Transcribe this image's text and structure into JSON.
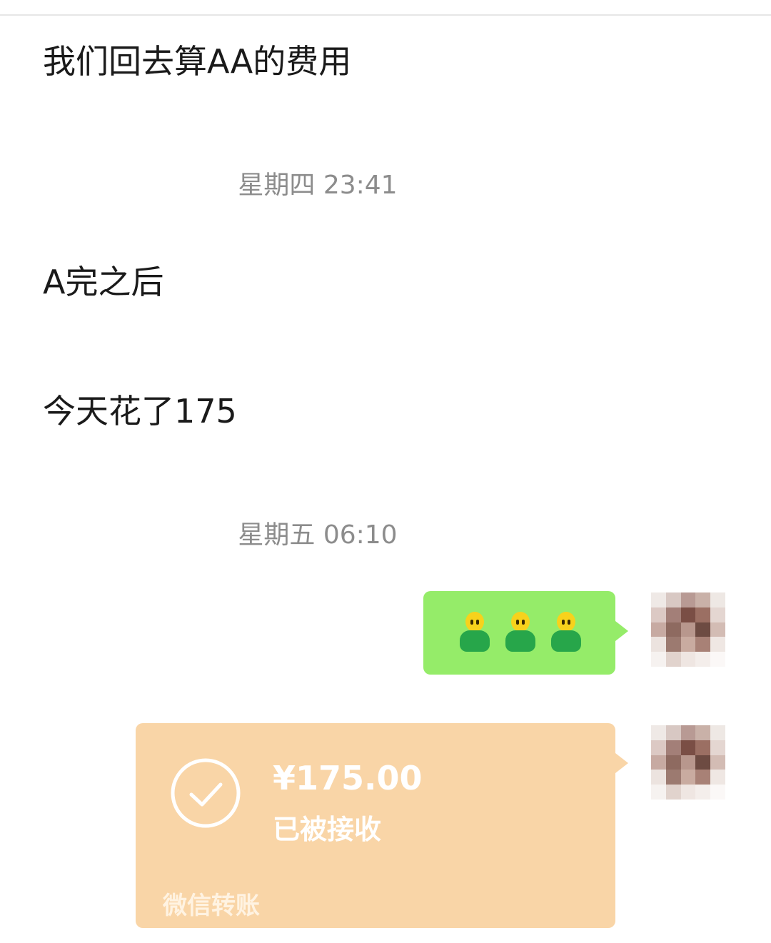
{
  "messages": {
    "m1": "我们回去算AA的费用",
    "ts1": "星期四 23:41",
    "m2": "A完之后",
    "m3": "今天花了175",
    "ts2": "星期五 06:10"
  },
  "sent_emoji": {
    "icon": "person-green-shirt-emoji",
    "count": 3
  },
  "transfer": {
    "amount": "¥175.00",
    "status": "已被接收",
    "footer": "微信转账"
  },
  "colors": {
    "sent_bubble": "#95ec69",
    "transfer_card": "#f9d5a7"
  }
}
